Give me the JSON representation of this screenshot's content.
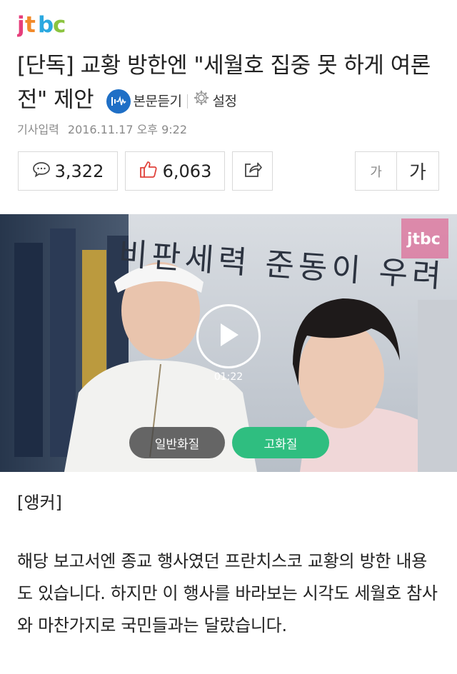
{
  "brand": {
    "logo_text": "jtbc"
  },
  "article": {
    "title": "[단독] 교황 방한엔 \"세월호 집중 못 하게 여론전\" 제안",
    "listen_label": "본문듣기",
    "settings_label": "설정",
    "published_label": "기사입력",
    "published_value": "2016.11.17 오후 9:22"
  },
  "actions": {
    "comment_count": "3,322",
    "like_count": "6,063",
    "font_small_label": "가",
    "font_large_label": "가"
  },
  "video": {
    "caption_overlay": "비판세력 준동이 우려",
    "channel_logo": "jtbc",
    "duration": "01:22",
    "quality_normal_label": "일반화질",
    "quality_hd_label": "고화질"
  },
  "content": {
    "anchor_label": "[앵커]",
    "paragraph": "해당 보고서엔 종교 행사였던 프란치스코 교황의 방한 내용도 있습니다. 하지만 이 행사를 바라보는 시각도 세월호 참사와 마찬가지로 국민들과는 달랐습니다."
  },
  "colors": {
    "accent_blue": "#1f6fc6",
    "hd_green": "#2fbe80",
    "like_red": "#e0413a"
  },
  "icons": [
    "jtbc-logo",
    "listen-icon",
    "gear-icon",
    "comment-icon",
    "thumbs-up-icon",
    "share-icon",
    "play-icon"
  ]
}
